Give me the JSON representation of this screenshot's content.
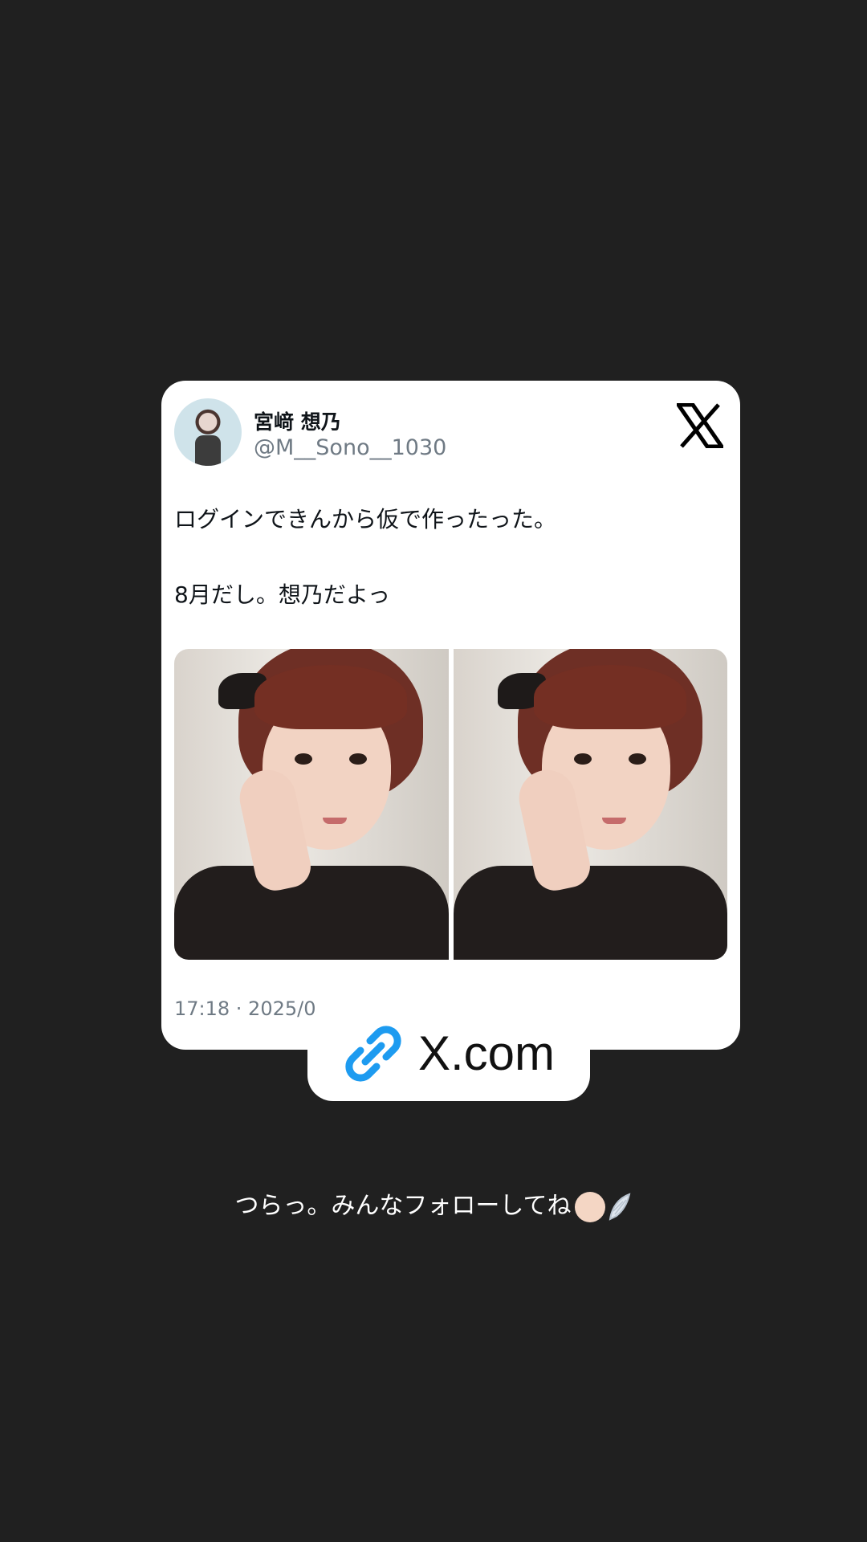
{
  "tweet": {
    "display_name": "宮﨑 想乃",
    "handle": "@M__Sono__1030",
    "text_line1": "ログインできんから仮で作ったった。",
    "text_line2": "8月だし。想乃だよっ",
    "timestamp": "17:18 · 2025/0",
    "platform_icon": "x-logo-icon",
    "photo_count": 2
  },
  "link_sticker": {
    "label": "X.com",
    "icon": "link-icon",
    "icon_color": "#1d9bf0"
  },
  "caption": {
    "text": "つらっ。みんなフォローしてね",
    "emojis": [
      "baby-face-emoji",
      "wing-emoji"
    ]
  },
  "colors": {
    "background": "#202020",
    "card": "#ffffff",
    "secondary_text": "#6f7a84"
  }
}
